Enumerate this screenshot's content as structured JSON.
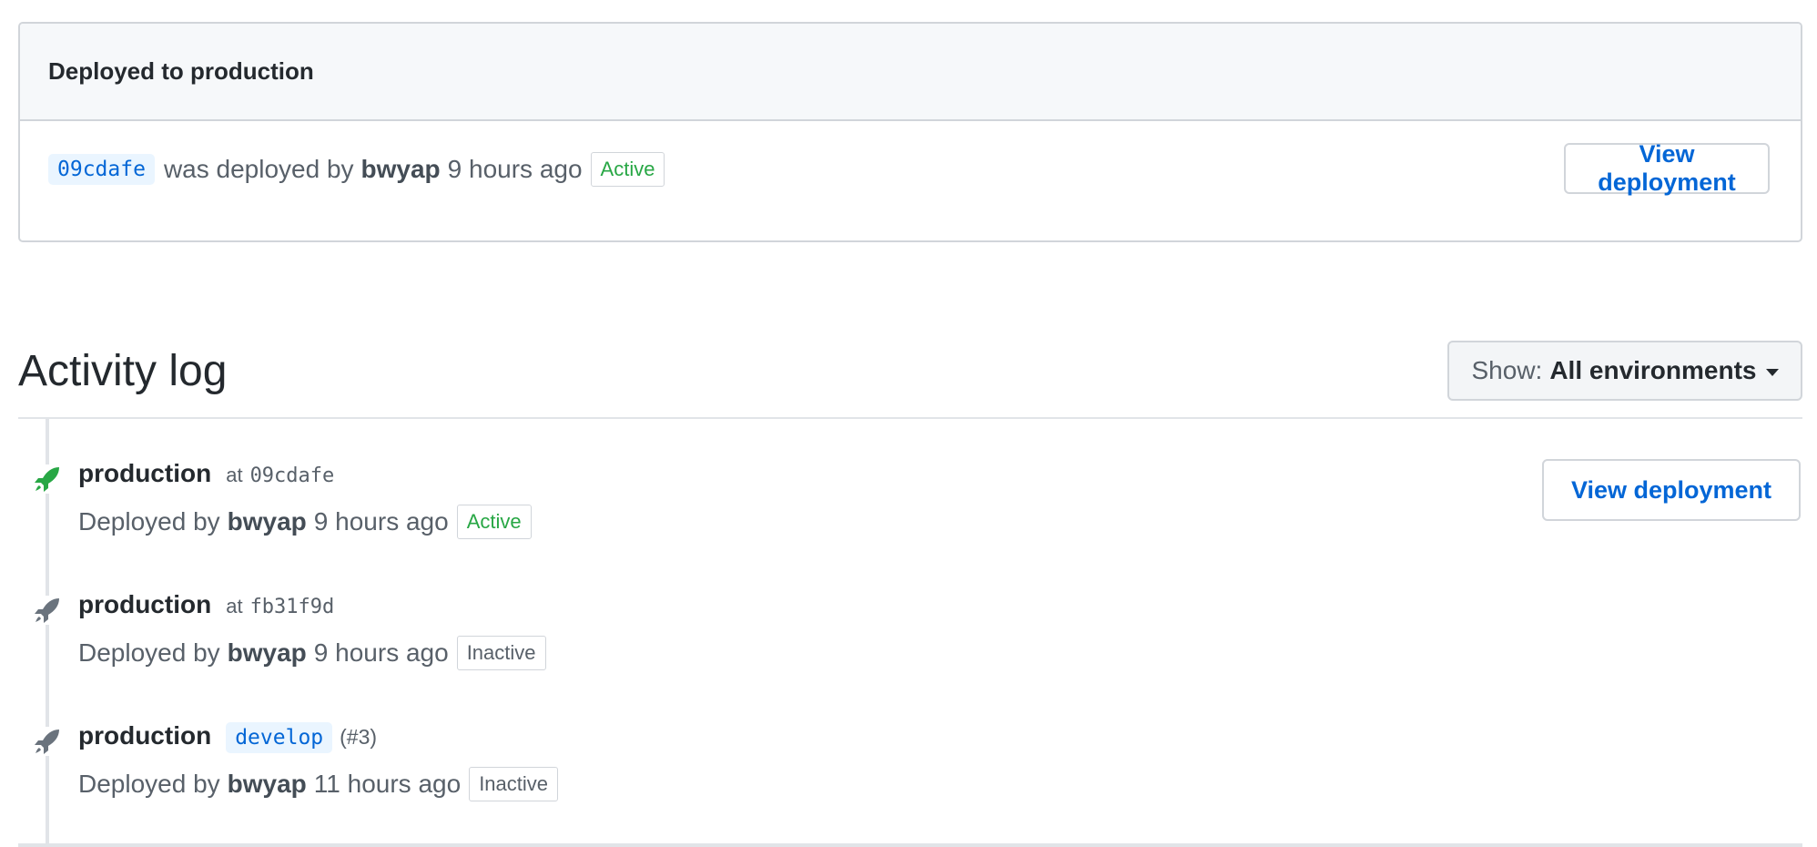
{
  "deployed_box": {
    "heading": "Deployed to production",
    "sha": "09cdafe",
    "text_was_deployed_by": "was deployed by",
    "user": "bwyap",
    "time": "9 hours ago",
    "status": "Active",
    "view_button": "View deployment"
  },
  "activity_log": {
    "title": "Activity log",
    "filter": {
      "label": "Show:",
      "value": "All environments"
    },
    "entries": [
      {
        "environment": "production",
        "at_label": "at",
        "ref": "09cdafe",
        "deployed_by_label": "Deployed by",
        "user": "bwyap",
        "time": "9 hours ago",
        "status": "Active",
        "view_button": "View deployment"
      },
      {
        "environment": "production",
        "at_label": "at",
        "ref": "fb31f9d",
        "deployed_by_label": "Deployed by",
        "user": "bwyap",
        "time": "9 hours ago",
        "status": "Inactive"
      },
      {
        "environment": "production",
        "branch": "develop",
        "pr": "(#3)",
        "deployed_by_label": "Deployed by",
        "user": "bwyap",
        "time": "11 hours ago",
        "status": "Inactive"
      }
    ]
  },
  "colors": {
    "link_blue": "#0366d6",
    "active_green": "#28a745",
    "inactive_gray": "#586069",
    "rocket_active": "#28a745",
    "rocket_inactive": "#6a737d"
  },
  "icons": {
    "deployment_icon": "rocket-icon",
    "dropdown_icon": "caret-down-icon"
  }
}
